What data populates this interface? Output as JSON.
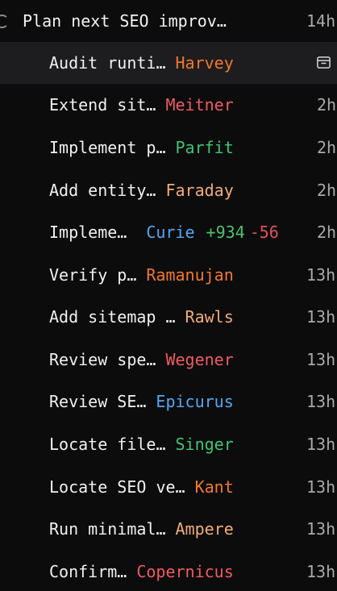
{
  "parent": {
    "title": "Plan next SEO improv…",
    "time": "14h"
  },
  "colors": {
    "orange": "#f2782f",
    "red": "#ef5b5f",
    "green": "#41c471",
    "peach": "#f3ab78",
    "blue": "#55a7f5"
  },
  "tasks": [
    {
      "title": "Audit runti…",
      "agent": "Harvey",
      "agent_color": "orange",
      "time": "",
      "icon": "archive-icon"
    },
    {
      "title": "Extend sit…",
      "agent": "Meitner",
      "agent_color": "red",
      "time": "2h"
    },
    {
      "title": "Implement p…",
      "agent": "Parfit",
      "agent_color": "green",
      "time": "2h"
    },
    {
      "title": "Add entity…",
      "agent": "Faraday",
      "agent_color": "peach",
      "time": "2h"
    },
    {
      "title": "Impleme…",
      "agent": "Curie",
      "agent_color": "blue",
      "time": "2h",
      "additions": "+934",
      "deletions": "-56"
    },
    {
      "title": "Verify p…",
      "agent": "Ramanujan",
      "agent_color": "orange",
      "time": "13h"
    },
    {
      "title": "Add sitemap …",
      "agent": "Rawls",
      "agent_color": "peach",
      "time": "13h"
    },
    {
      "title": "Review spe…",
      "agent": "Wegener",
      "agent_color": "red",
      "time": "13h"
    },
    {
      "title": "Review SE…",
      "agent": "Epicurus",
      "agent_color": "blue",
      "time": "13h"
    },
    {
      "title": "Locate file…",
      "agent": "Singer",
      "agent_color": "green",
      "time": "13h"
    },
    {
      "title": "Locate SEO ve…",
      "agent": "Kant",
      "agent_color": "orange",
      "time": "13h"
    },
    {
      "title": "Run minimal…",
      "agent": "Ampere",
      "agent_color": "peach",
      "time": "13h"
    },
    {
      "title": "Confirm…",
      "agent": "Copernicus",
      "agent_color": "red",
      "time": "13h"
    }
  ]
}
